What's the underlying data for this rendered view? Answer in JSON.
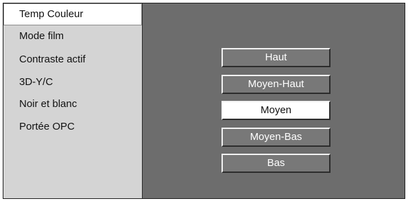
{
  "menu": {
    "items": [
      {
        "label": "Temp Couleur"
      },
      {
        "label": "Mode film"
      },
      {
        "label": "Contraste actif"
      },
      {
        "label": "3D-Y/C"
      },
      {
        "label": "Noir et blanc"
      },
      {
        "label": "Portée OPC"
      }
    ],
    "selected_index": 0
  },
  "options": {
    "items": [
      {
        "label": "Haut"
      },
      {
        "label": "Moyen-Haut"
      },
      {
        "label": "Moyen"
      },
      {
        "label": "Moyen-Bas"
      },
      {
        "label": "Bas"
      }
    ],
    "selected_index": 2
  },
  "colors": {
    "panel_background": "#6d6d6d",
    "sidebar_background": "#d4d4d4",
    "selected_background": "#ffffff",
    "button_background": "#787878"
  }
}
